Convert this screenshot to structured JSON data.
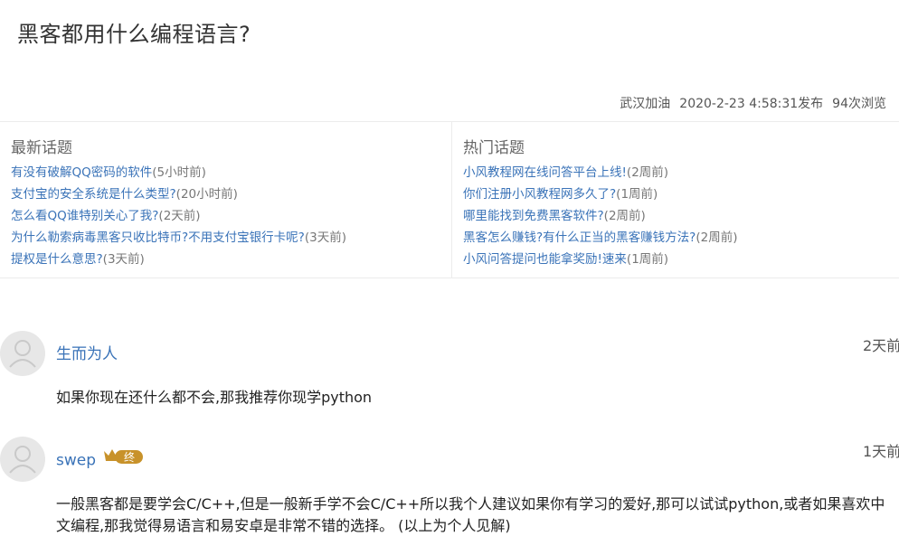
{
  "question": {
    "title": "黑客都用什么编程语言?",
    "author": "武汉加油",
    "published": "2020-2-23 4:58:31发布",
    "views": "94次浏览"
  },
  "latest": {
    "heading": "最新话题",
    "items": [
      {
        "text": "有没有破解QQ密码的软件",
        "ago": "(5小时前)"
      },
      {
        "text": "支付宝的安全系统是什么类型?",
        "ago": "(20小时前)"
      },
      {
        "text": "怎么看QQ谁特别关心了我?",
        "ago": "(2天前)"
      },
      {
        "text": "为什么勒索病毒黑客只收比特币?不用支付宝银行卡呢?",
        "ago": "(3天前)"
      },
      {
        "text": "提权是什么意思?",
        "ago": "(3天前)"
      }
    ]
  },
  "hot": {
    "heading": "热门话题",
    "items": [
      {
        "text": "小风教程网在线问答平台上线!",
        "ago": "(2周前)"
      },
      {
        "text": "你们注册小风教程网多久了?",
        "ago": "(1周前)"
      },
      {
        "text": "哪里能找到免费黑客软件?",
        "ago": "(2周前)"
      },
      {
        "text": "黑客怎么赚钱?有什么正当的黑客赚钱方法?",
        "ago": "(2周前)"
      },
      {
        "text": "小风问答提问也能拿奖励!速来",
        "ago": "(1周前)"
      }
    ]
  },
  "answers": [
    {
      "user": "生而为人",
      "time": "2天前",
      "content": "如果你现在还什么都不会,那我推荐你现学python"
    },
    {
      "user": "swep",
      "badge": "终",
      "time": "1天前",
      "content": "一般黑客都是要学会C/C++,但是一般新手学不会C/C++所以我个人建议如果你有学习的爱好,那可以试试python,或者如果喜欢中文编程,那我觉得易语言和易安卓是非常不错的选择。 (以上为个人见解)"
    }
  ],
  "colors": {
    "link": "#3a73b8",
    "badge": "#c8922a"
  }
}
